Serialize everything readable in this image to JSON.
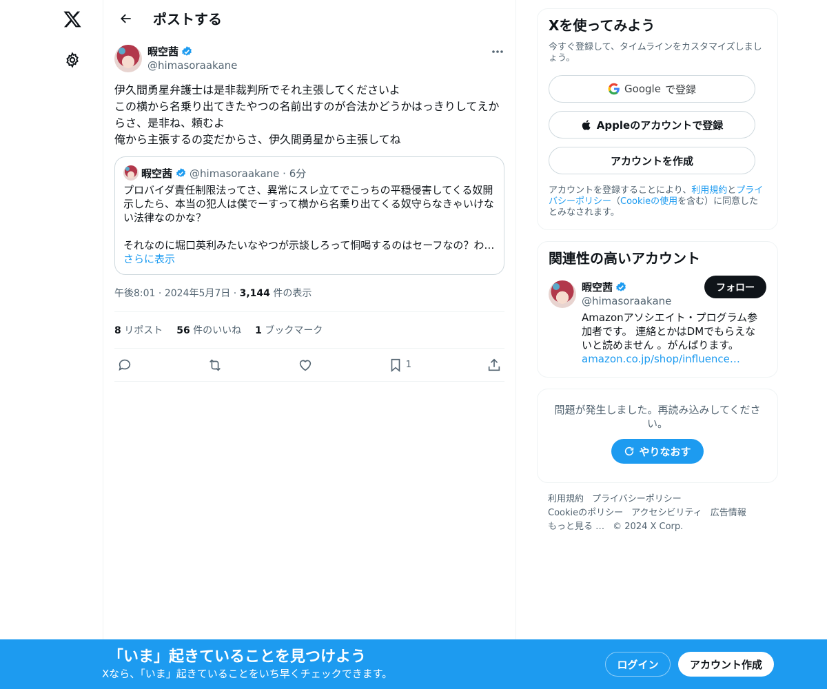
{
  "header": {
    "title": "ポストする"
  },
  "post": {
    "author": {
      "name": "暇空茜",
      "handle": "@himasoraakane"
    },
    "text": "伊久間勇星弁護士は是非裁判所でそれ主張してくださいよ\nこの横から名乗り出てきたやつの名前出すのが合法かどうかはっきりしてえからさ、是非ね、頼むよ\n俺から主張するの変だからさ、伊久間勇星から主張してね",
    "quote": {
      "name": "暇空茜",
      "meta": "@himasoraakane · 6分",
      "text": "プロバイダ責任制限法ってさ、異常にスレ立てでこっちの平穏侵害してくる奴開示したら、本当の犯人は僕でーすって横から名乗り出てくる奴守らなきゃいけない法律なのかな？\n\nそれなのに堀口英利みたいなやつが示談しろって恫喝するのはセーフなの？わ…",
      "more": "さらに表示"
    },
    "time": "午後8:01",
    "date": "2024年5月7日",
    "views_count": "3,144",
    "views_label": "件の表示",
    "stats": {
      "reposts_count": "8",
      "reposts_label": "リポスト",
      "likes_count": "56",
      "likes_label": "件のいいね",
      "bookmarks_count": "1",
      "bookmarks_label": "ブックマーク"
    },
    "bookmark_action_count": "1"
  },
  "signup": {
    "title": "Xを使ってみよう",
    "subtitle": "今すぐ登録して、タイムラインをカスタマイズしましょう。",
    "google_brand": "Google",
    "google_suffix": "で登録",
    "apple": "Appleのアカウントで登録",
    "create": "アカウントを作成",
    "terms_a": "アカウントを登録することにより、",
    "terms_link1": "利用規約",
    "terms_b": "と",
    "terms_link2": "プライバシーポリシー",
    "terms_c": "（",
    "terms_link3": "Cookieの使用",
    "terms_d": "を含む）に同意したとみなされます。"
  },
  "related": {
    "title": "関連性の高いアカウント",
    "name": "暇空茜",
    "handle": "@himasoraakane",
    "follow": "フォロー",
    "bio": "Amazonアソシエイト・プログラム参加者です。 連絡とかはDMでもらえないと読めません 。がんばります。",
    "bio_link": "amazon.co.jp/shop/influence…"
  },
  "error": {
    "message": "問題が発生しました。再読み込みしてください。",
    "retry": "やりなおす"
  },
  "footer": {
    "terms": "利用規約",
    "privacy": "プライバシーポリシー",
    "cookie": "Cookieのポリシー",
    "accessibility": "アクセシビリティ",
    "ads": "広告情報",
    "more": "もっと見る …",
    "copyright": "© 2024 X Corp."
  },
  "banner": {
    "title": "「いま」起きていることを見つけよう",
    "subtitle": "Xなら、「いま」起きていることをいち早くチェックできます。",
    "login": "ログイン",
    "signup": "アカウント作成"
  },
  "colors": {
    "accent": "#1d9bf0",
    "text": "#0f1419",
    "secondary": "#536471",
    "border": "#eff3f4"
  }
}
